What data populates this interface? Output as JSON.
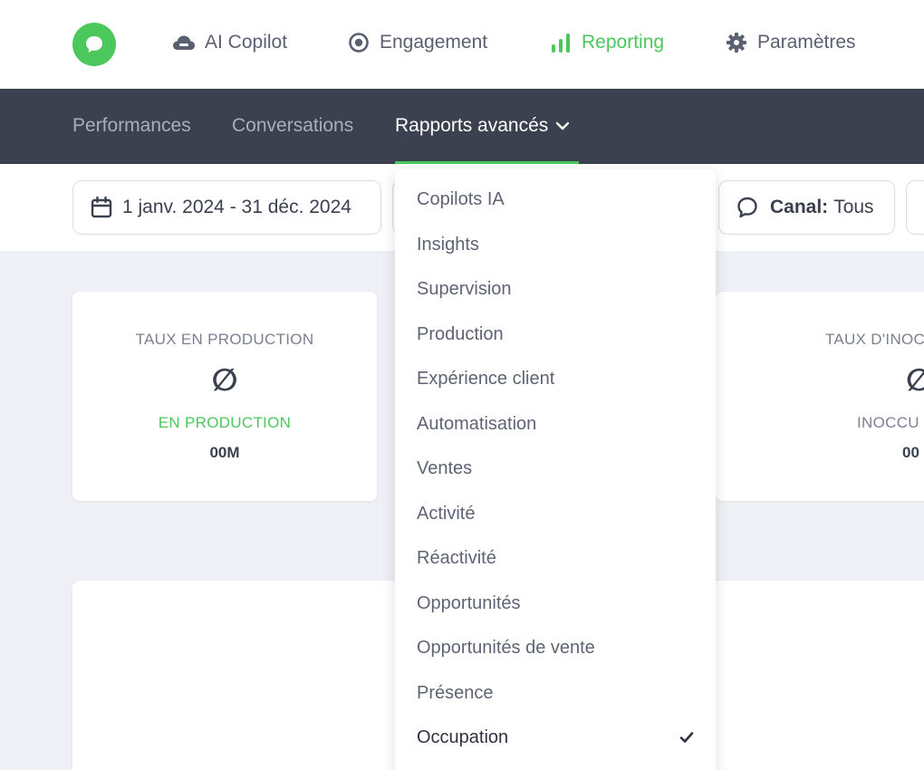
{
  "topnav": {
    "items": [
      {
        "label": "AI Copilot"
      },
      {
        "label": "Engagement"
      },
      {
        "label": "Reporting"
      },
      {
        "label": "Paramètres"
      }
    ]
  },
  "subnav": {
    "items": [
      {
        "label": "Performances"
      },
      {
        "label": "Conversations"
      },
      {
        "label": "Rapports avancés"
      }
    ]
  },
  "filters": {
    "date_range": "1 janv. 2024 - 31 déc. 2024",
    "channel_key": "Canal:",
    "channel_value": "Tous"
  },
  "kpis": [
    {
      "title": "TAUX EN PRODUCTION",
      "symbol": "∅",
      "sub": "EN PRODUCTION",
      "value": "00M"
    },
    {
      "title": "TAUX D'INOC",
      "symbol": "∅",
      "sub": "INOCCU",
      "value": "00"
    }
  ],
  "dropdown": {
    "items": [
      {
        "label": "Copilots IA"
      },
      {
        "label": "Insights"
      },
      {
        "label": "Supervision"
      },
      {
        "label": "Production"
      },
      {
        "label": "Expérience client"
      },
      {
        "label": "Automatisation"
      },
      {
        "label": "Ventes"
      },
      {
        "label": "Activité"
      },
      {
        "label": "Réactivité"
      },
      {
        "label": "Opportunités"
      },
      {
        "label": "Opportunités de vente"
      },
      {
        "label": "Présence"
      },
      {
        "label": "Occupation"
      }
    ],
    "selected": "Occupation"
  },
  "colors": {
    "brand_green": "#4bc75c",
    "subnav_bg": "#3b414f",
    "page_bg": "#eef0f5"
  }
}
